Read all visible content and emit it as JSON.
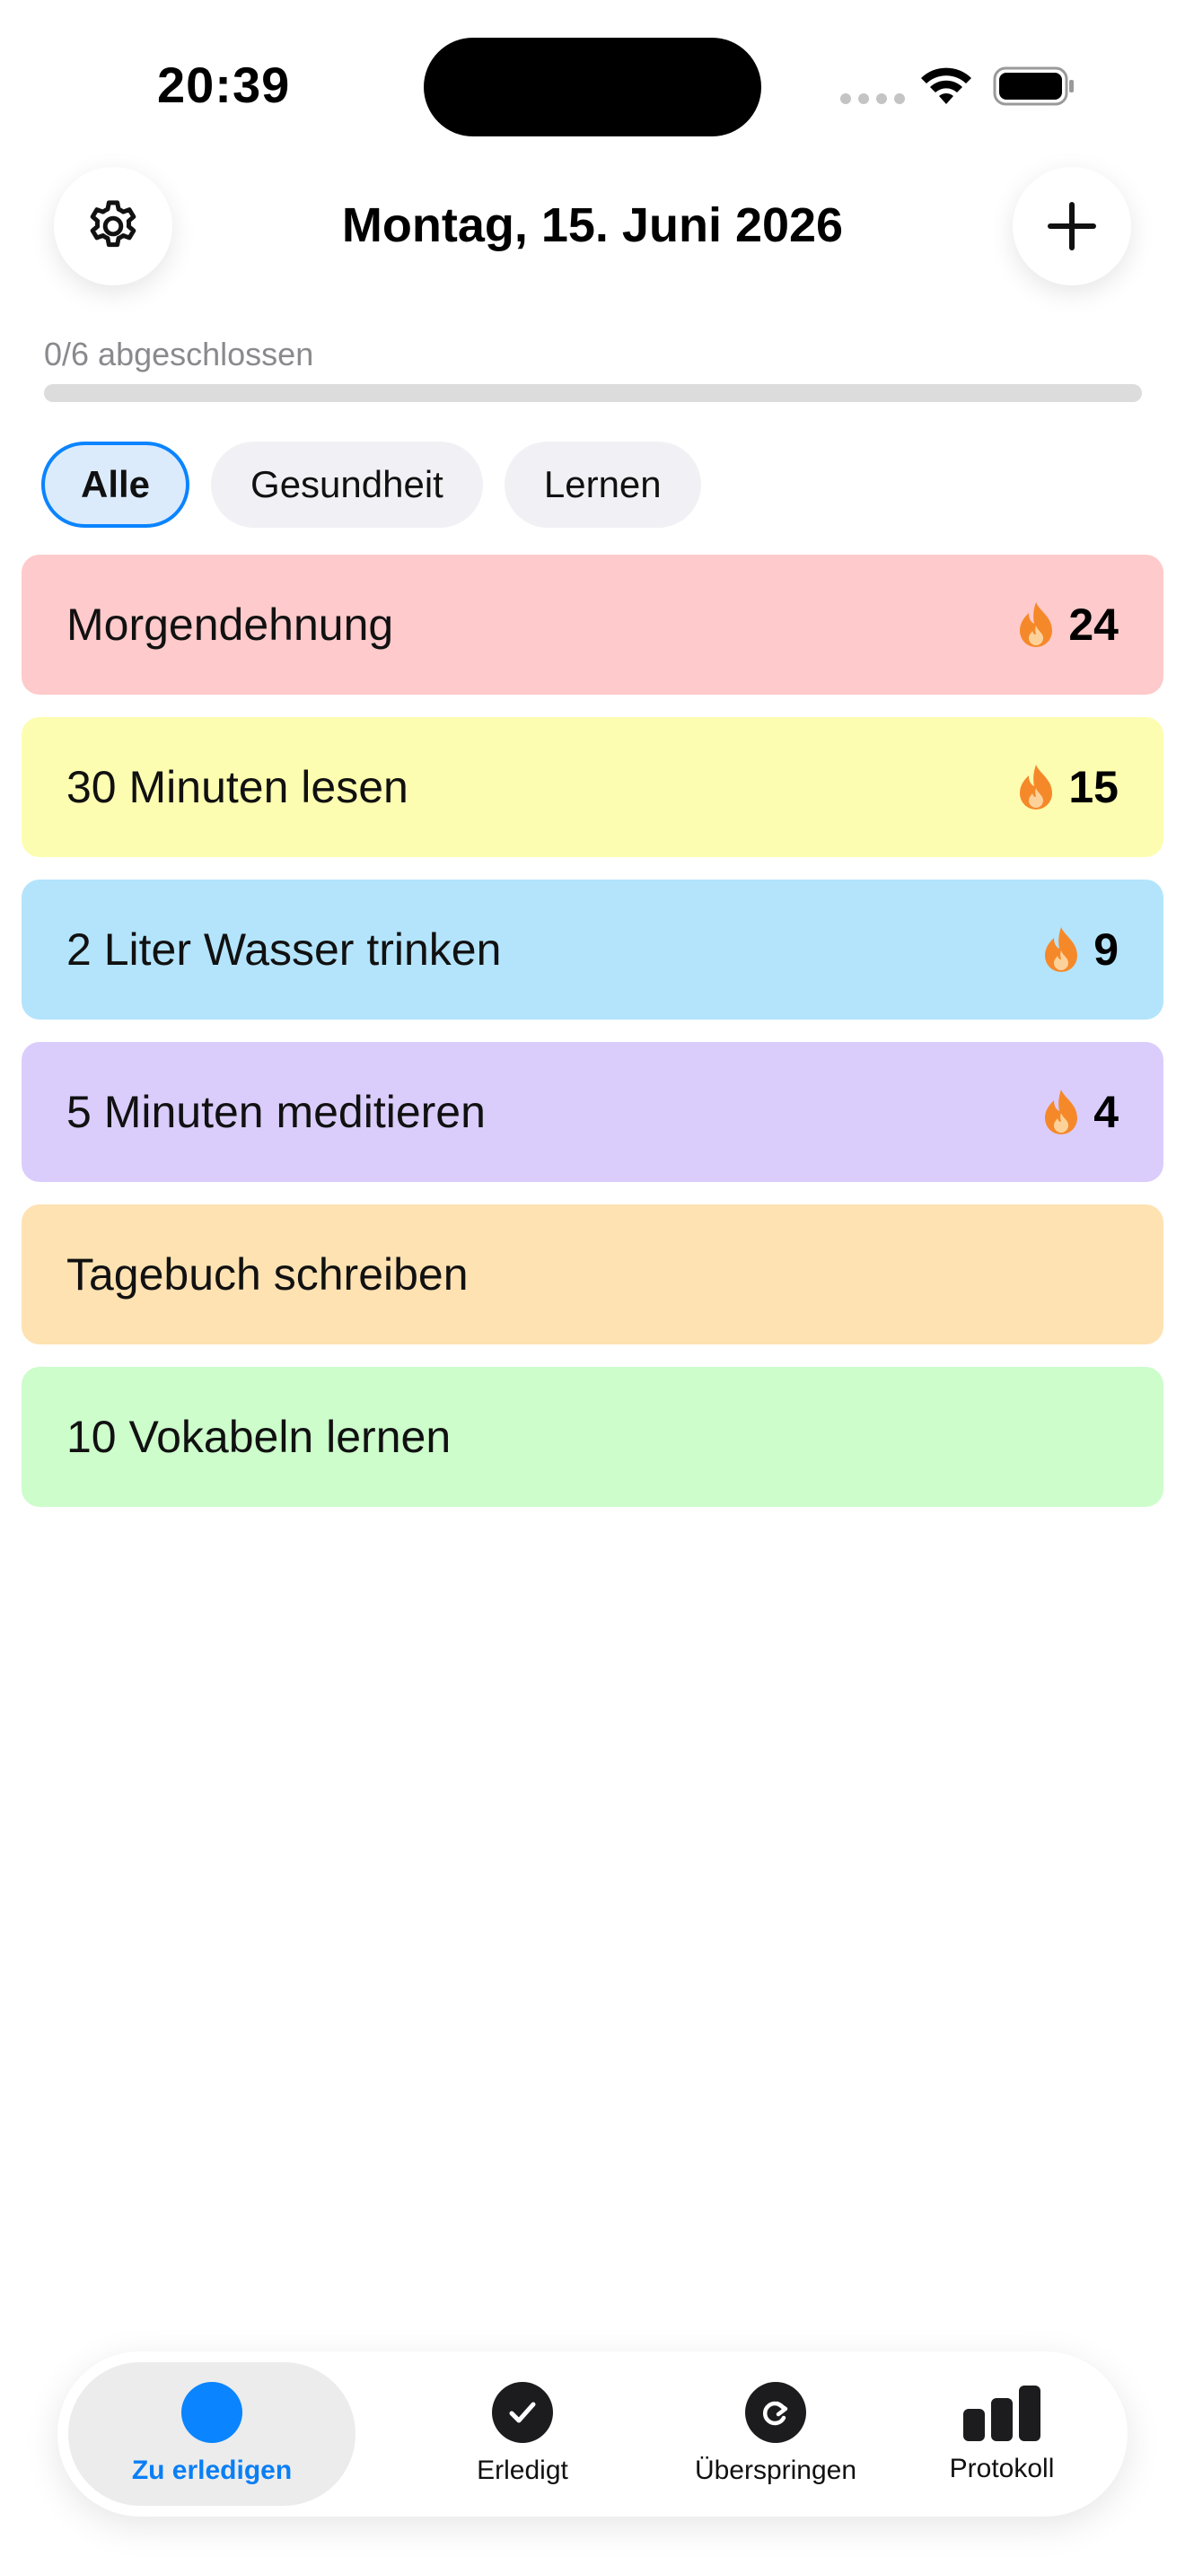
{
  "status_bar": {
    "time": "20:39"
  },
  "header": {
    "title": "Montag, 15. Juni 2026",
    "settings_icon": "gear-icon",
    "add_icon": "plus-icon"
  },
  "progress": {
    "label": "0/6 abgeschlossen",
    "completed": 0,
    "total": 6,
    "fraction": 0
  },
  "filters": [
    {
      "label": "Alle",
      "active": true
    },
    {
      "label": "Gesundheit",
      "active": false
    },
    {
      "label": "Lernen",
      "active": false
    }
  ],
  "habits": [
    {
      "name": "Morgendehnung",
      "streak": "24",
      "color": "#fecacb"
    },
    {
      "name": "30 Minuten lesen",
      "streak": "15",
      "color": "#fdfdb1"
    },
    {
      "name": "2 Liter Wasser trinken",
      "streak": "9",
      "color": "#b3e4fc"
    },
    {
      "name": "5 Minuten meditieren",
      "streak": "4",
      "color": "#dacdfc"
    },
    {
      "name": "Tagebuch schreiben",
      "streak": null,
      "color": "#fee2b2"
    },
    {
      "name": "10 Vokabeln lernen",
      "streak": null,
      "color": "#ccfdcb"
    }
  ],
  "tab_bar": {
    "tabs": [
      {
        "label": "Zu erledigen",
        "icon": "circle-icon",
        "active": true
      },
      {
        "label": "Erledigt",
        "icon": "checkmark-icon",
        "active": false
      },
      {
        "label": "Überspringen",
        "icon": "skip-arrow-icon",
        "active": false
      },
      {
        "label": "Protokoll",
        "icon": "bar-chart-icon",
        "active": false
      }
    ]
  },
  "colors": {
    "accent": "#0a84ff",
    "streak_flame": "#f5892a"
  }
}
